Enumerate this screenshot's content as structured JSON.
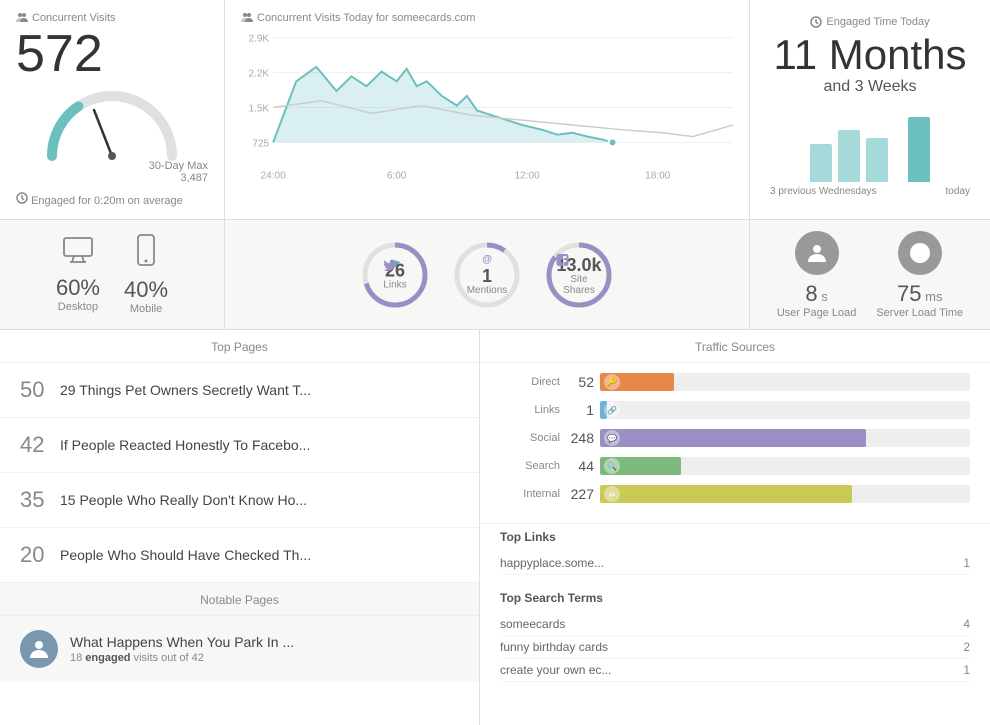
{
  "topLeft": {
    "title": "Concurrent Visits",
    "number": "572",
    "maxLabel": "30-Day Max",
    "maxValue": "3,487",
    "engagedText": "Engaged for 0:20m on average"
  },
  "topCenter": {
    "title": "Concurrent Visits Today for someecards.com",
    "xLabels": [
      "24:00",
      "6:00",
      "12:00",
      "18:00"
    ],
    "yLabels": [
      "2.9K",
      "2.2K",
      "1.5K",
      "725"
    ]
  },
  "topRight": {
    "title": "Engaged Time Today",
    "timeMain": "11 Months",
    "timeSub": "and 3 Weeks",
    "prevLabel": "3 previous Wednesdays",
    "todayLabel": "today"
  },
  "devices": [
    {
      "icon": "desktop",
      "pct": "60%",
      "label": "Desktop"
    },
    {
      "icon": "mobile",
      "pct": "40%",
      "label": "Mobile"
    }
  ],
  "socialStats": [
    {
      "icon": "twitter",
      "number": "26",
      "label": "Links",
      "color": "#9b8ec4",
      "pct": 70
    },
    {
      "icon": "mention",
      "number": "1",
      "label": "Mentions",
      "color": "#9b8ec4",
      "pct": 10
    },
    {
      "icon": "facebook",
      "number": "13.0k",
      "label": "Site Shares",
      "color": "#9b8ec4",
      "pct": 85
    }
  ],
  "serverStats": [
    {
      "number": "8",
      "unit": "s",
      "label": "User Page Load"
    },
    {
      "number": "75",
      "unit": "ms",
      "label": "Server Load Time"
    }
  ],
  "topPages": {
    "title": "Top Pages",
    "items": [
      {
        "num": "50",
        "title": "29 Things Pet Owners Secretly Want T..."
      },
      {
        "num": "42",
        "title": "If People Reacted Honestly To Facebo..."
      },
      {
        "num": "35",
        "title": "15 People Who Really Don't Know Ho..."
      },
      {
        "num": "20",
        "title": "People Who Should Have Checked Th..."
      }
    ],
    "notableTitle": "Notable Pages",
    "notableItem": {
      "title": "What Happens When You Park In ...",
      "sub": "18 engaged visits out of 42"
    }
  },
  "traffic": {
    "title": "Traffic Sources",
    "items": [
      {
        "label": "Direct",
        "count": "52",
        "pct": 20,
        "color": "#e8874a"
      },
      {
        "label": "Links",
        "count": "1",
        "pct": 2,
        "color": "#6db3d8"
      },
      {
        "label": "Social",
        "count": "248",
        "pct": 72,
        "color": "#9b8ec4"
      },
      {
        "label": "Search",
        "count": "44",
        "pct": 22,
        "color": "#7db87d"
      },
      {
        "label": "Internal",
        "count": "227",
        "pct": 68,
        "color": "#c9c955"
      }
    ],
    "topLinks": {
      "title": "Top Links",
      "items": [
        {
          "label": "happyplace.some...",
          "count": "1"
        }
      ]
    },
    "topSearchTerms": {
      "title": "Top Search Terms",
      "items": [
        {
          "label": "someecards",
          "count": "4"
        },
        {
          "label": "funny birthday cards",
          "count": "2"
        },
        {
          "label": "create your own ec...",
          "count": "1"
        }
      ]
    }
  }
}
